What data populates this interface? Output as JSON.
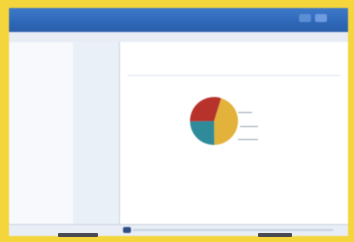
{
  "window": {
    "title": "",
    "close_icon": "close-icon",
    "maximize_icon": "maximize-icon"
  },
  "left_pane": {
    "items": [
      "",
      ""
    ]
  },
  "nav_pane": {
    "items": [
      {
        "label": ""
      },
      {
        "label": ""
      },
      {
        "label": "",
        "active": true
      },
      {
        "label": ""
      },
      {
        "label": ""
      }
    ]
  },
  "content": {
    "heading": "",
    "legend": [
      "",
      "",
      ""
    ]
  },
  "chart_data": {
    "type": "pie",
    "slices": [
      {
        "color": "#e2b23a",
        "value": 45
      },
      {
        "color": "#2f8a9a",
        "value": 25
      },
      {
        "color": "#b8322c",
        "value": 30
      }
    ]
  },
  "colors": {
    "frame": "#f4d53c",
    "titlebar": "#2f67b8"
  }
}
